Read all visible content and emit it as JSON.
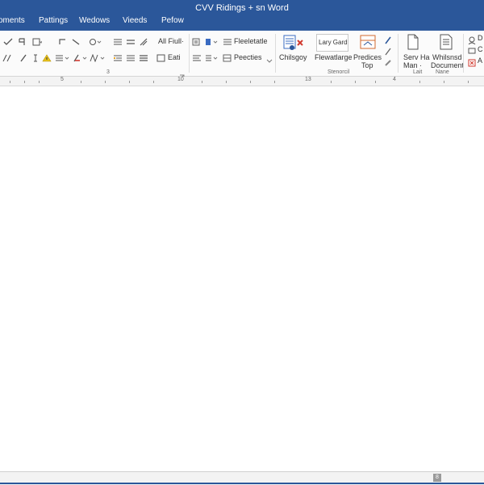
{
  "window": {
    "title": "CVV Ridings + sn Word"
  },
  "menu": [
    "oments",
    "Pattings",
    "Wedows",
    "Vieeds",
    "Pefow"
  ],
  "ribbon": {
    "font_group_label": "3",
    "paragraph_all_full": "All Fiull·",
    "paragraph_eati": "Eati",
    "styles_flee_letatle": "Fleeletatle",
    "styles_peectes": "Peecties",
    "editing_chilsgoy": "Chilsgoy",
    "lary_gard": "Lary Gard",
    "flewatlarge": "Flewatlarge",
    "predices_top_1": "Predices",
    "predices_top_2": "Top",
    "group_stenorcil": "Stenorcil",
    "serv_ha_1": "Serv Ha",
    "serv_ha_2": "Man ·",
    "whilsnsd_1": "Whilsnsd",
    "whilsnsd_2": "Document",
    "group_lait": "Lait",
    "group_nane": "Nane",
    "right_d": "D",
    "right_c": "C",
    "right_a": "A"
  },
  "ruler": {
    "n5": "5",
    "n10": "10",
    "n13": "13",
    "n4": "4"
  },
  "status": {
    "btn": "8"
  }
}
